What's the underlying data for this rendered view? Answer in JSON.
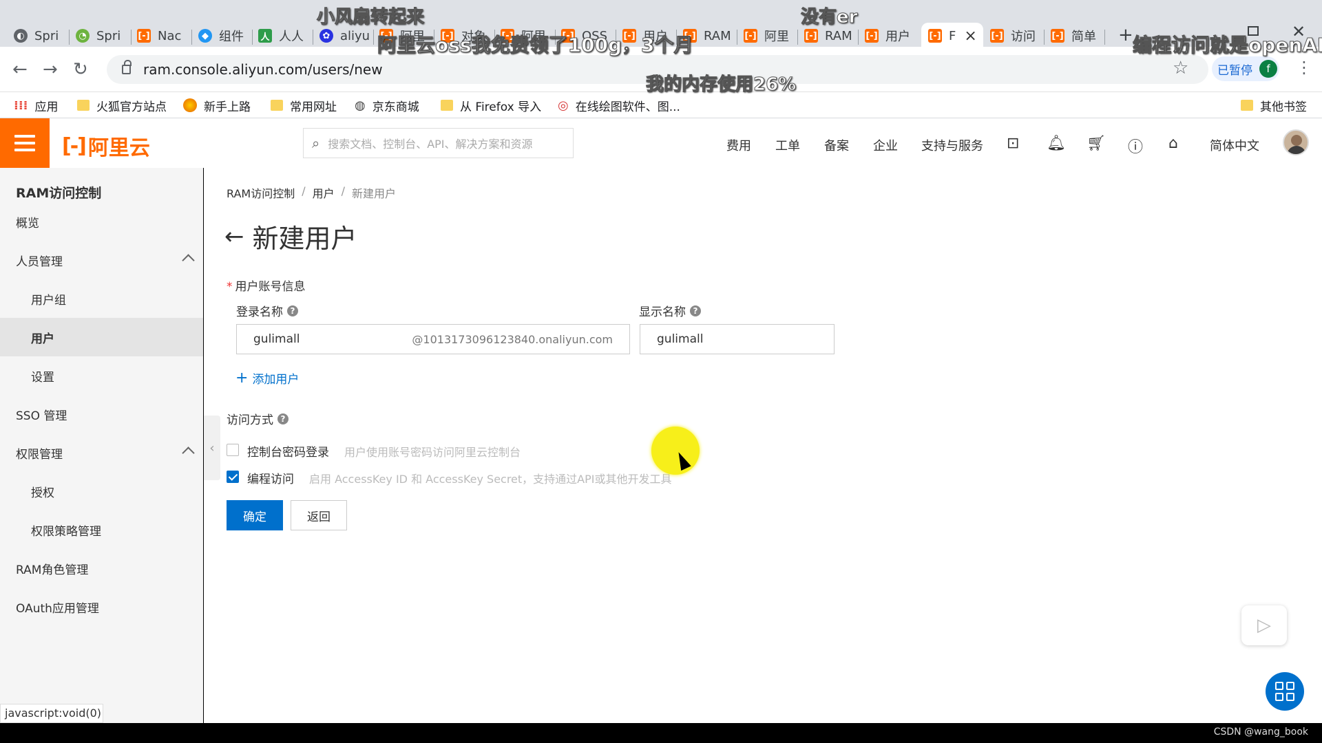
{
  "browser": {
    "tabs": [
      {
        "label": "Spri",
        "icon": "spring-favicon-icon"
      },
      {
        "label": "Spri",
        "icon": "spring-favicon-icon"
      },
      {
        "label": "Nac",
        "icon": "aliyun-favicon-icon"
      },
      {
        "label": "组件",
        "icon": "vue-favicon-icon"
      },
      {
        "label": "人人",
        "icon": "renren-favicon-icon"
      },
      {
        "label": "aliyu",
        "icon": "baidu-favicon-icon"
      },
      {
        "label": "阿里",
        "icon": "aliyun-favicon-icon"
      },
      {
        "label": "对象",
        "icon": "aliyun-favicon-icon"
      },
      {
        "label": "阿里",
        "icon": "aliyun-favicon-icon"
      },
      {
        "label": "OSS",
        "icon": "aliyun-favicon-icon"
      },
      {
        "label": "用户",
        "icon": "aliyun-favicon-icon"
      },
      {
        "label": "RAM",
        "icon": "aliyun-favicon-icon"
      },
      {
        "label": "阿里",
        "icon": "aliyun-favicon-icon"
      },
      {
        "label": "RAM",
        "icon": "aliyun-favicon-icon"
      },
      {
        "label": "用户",
        "icon": "aliyun-favicon-icon"
      },
      {
        "label": "F",
        "icon": "aliyun-favicon-icon"
      },
      {
        "label": "访问",
        "icon": "aliyun-favicon-icon"
      },
      {
        "label": "简单",
        "icon": "aliyun-favicon-icon"
      }
    ],
    "new_tab": "+",
    "close_tab": "×",
    "url": "ram.console.aliyun.com/users/new",
    "paused_label": "已暂停",
    "profile_initial": "f",
    "bookmarks": [
      {
        "label": "应用",
        "icon": "apps-grid-icon"
      },
      {
        "label": "火狐官方站点",
        "icon": "folder-icon"
      },
      {
        "label": "新手上路",
        "icon": "firefox-icon"
      },
      {
        "label": "常用网址",
        "icon": "folder-icon"
      },
      {
        "label": "京东商城",
        "icon": "globe-icon"
      },
      {
        "label": "从 Firefox 导入",
        "icon": "folder-icon"
      },
      {
        "label": "在线绘图软件、图...",
        "icon": "drawio-icon"
      }
    ],
    "other_bookmarks": "其他书签",
    "status_bar": "javascript:void(0)"
  },
  "overlay": {
    "danmu": [
      "小风扇转起来",
      "没有er",
      "阿里云oss我免费领了100g，3个月",
      "编程访问就是openAP",
      "我的内存使用26%"
    ],
    "watermark": "CSDN @wang_book"
  },
  "header": {
    "logo_mark": "[-]",
    "logo_text": "阿里云",
    "search_placeholder": "搜索文档、控制台、API、解决方案和资源",
    "nav": [
      "费用",
      "工单",
      "备案",
      "企业",
      "支持与服务"
    ],
    "language": "简体中文"
  },
  "sidebar": {
    "title": "RAM访问控制",
    "items": [
      {
        "label": "概览",
        "level": 1
      },
      {
        "label": "人员管理",
        "level": 1,
        "expanded": true
      },
      {
        "label": "用户组",
        "level": 2
      },
      {
        "label": "用户",
        "level": 2,
        "active": true
      },
      {
        "label": "设置",
        "level": 2
      },
      {
        "label": "SSO 管理",
        "level": 1
      },
      {
        "label": "权限管理",
        "level": 1,
        "expanded": true
      },
      {
        "label": "授权",
        "level": 2
      },
      {
        "label": "权限策略管理",
        "level": 2
      },
      {
        "label": "RAM角色管理",
        "level": 1
      },
      {
        "label": "OAuth应用管理",
        "level": 1
      }
    ]
  },
  "main": {
    "breadcrumb": [
      "RAM访问控制",
      "用户",
      "新建用户"
    ],
    "title": "新建用户",
    "section_label": "用户账号信息",
    "login_name_label": "登录名称",
    "login_name_value": "gulimall",
    "login_name_suffix": "@1013173096123840.onaliyun.com",
    "display_name_label": "显示名称",
    "display_name_value": "gulimall",
    "add_user": "添加用户",
    "access_label": "访问方式",
    "options": [
      {
        "label": "控制台密码登录",
        "desc": "用户使用账号密码访问阿里云控制台",
        "checked": false
      },
      {
        "label": "编程访问",
        "desc": "启用 AccessKey ID 和 AccessKey Secret，支持通过API或其他开发工具",
        "checked": true
      }
    ],
    "confirm": "确定",
    "back": "返回"
  },
  "colors": {
    "brand": "#ff6a00",
    "primary": "#0070cc"
  }
}
